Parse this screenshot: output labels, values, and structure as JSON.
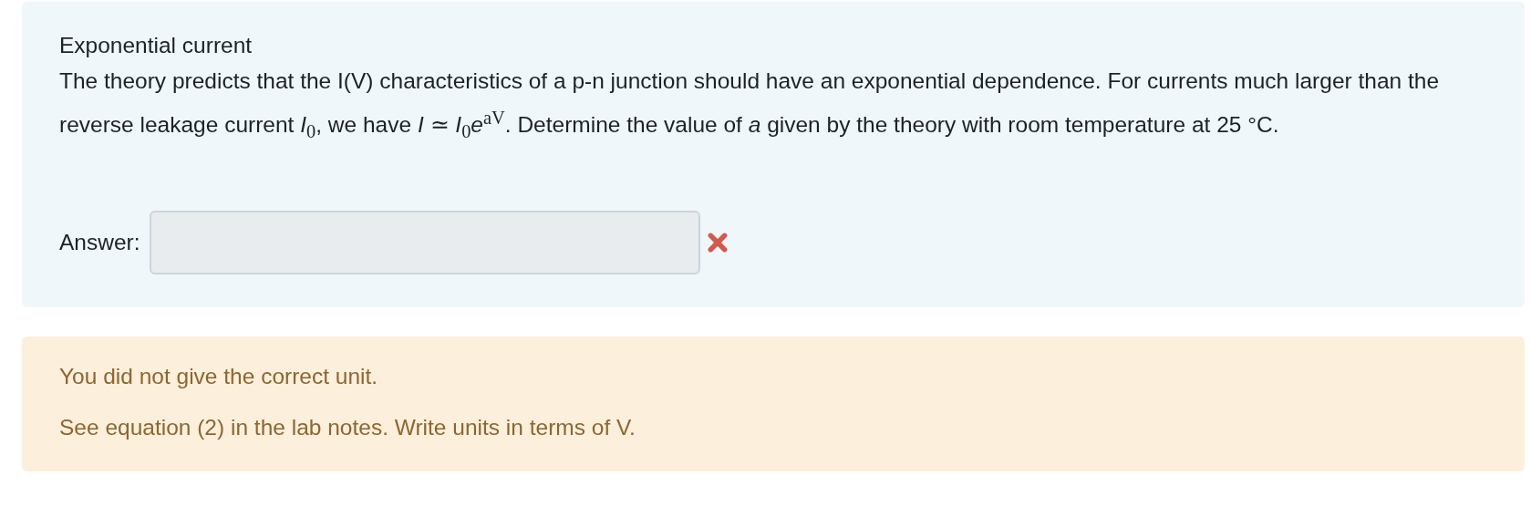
{
  "question": {
    "title": "Exponential current",
    "text": "The theory predicts that the I(V) characteristics of a p-n junction should have an exponential dependence. For currents much larger than the reverse leakage current *I*$_{0}$, we have *I* ≃ *I*$_{0}$*e*$^{aV}$. Determine the value of *a* given by the theory with room temperature at 25 °C.",
    "answer_label": "Answer:",
    "answer_correct": false
  },
  "feedback": [
    "You did not give the correct unit.",
    "See equation (2) in the lab notes. Write units in terms of V."
  ]
}
